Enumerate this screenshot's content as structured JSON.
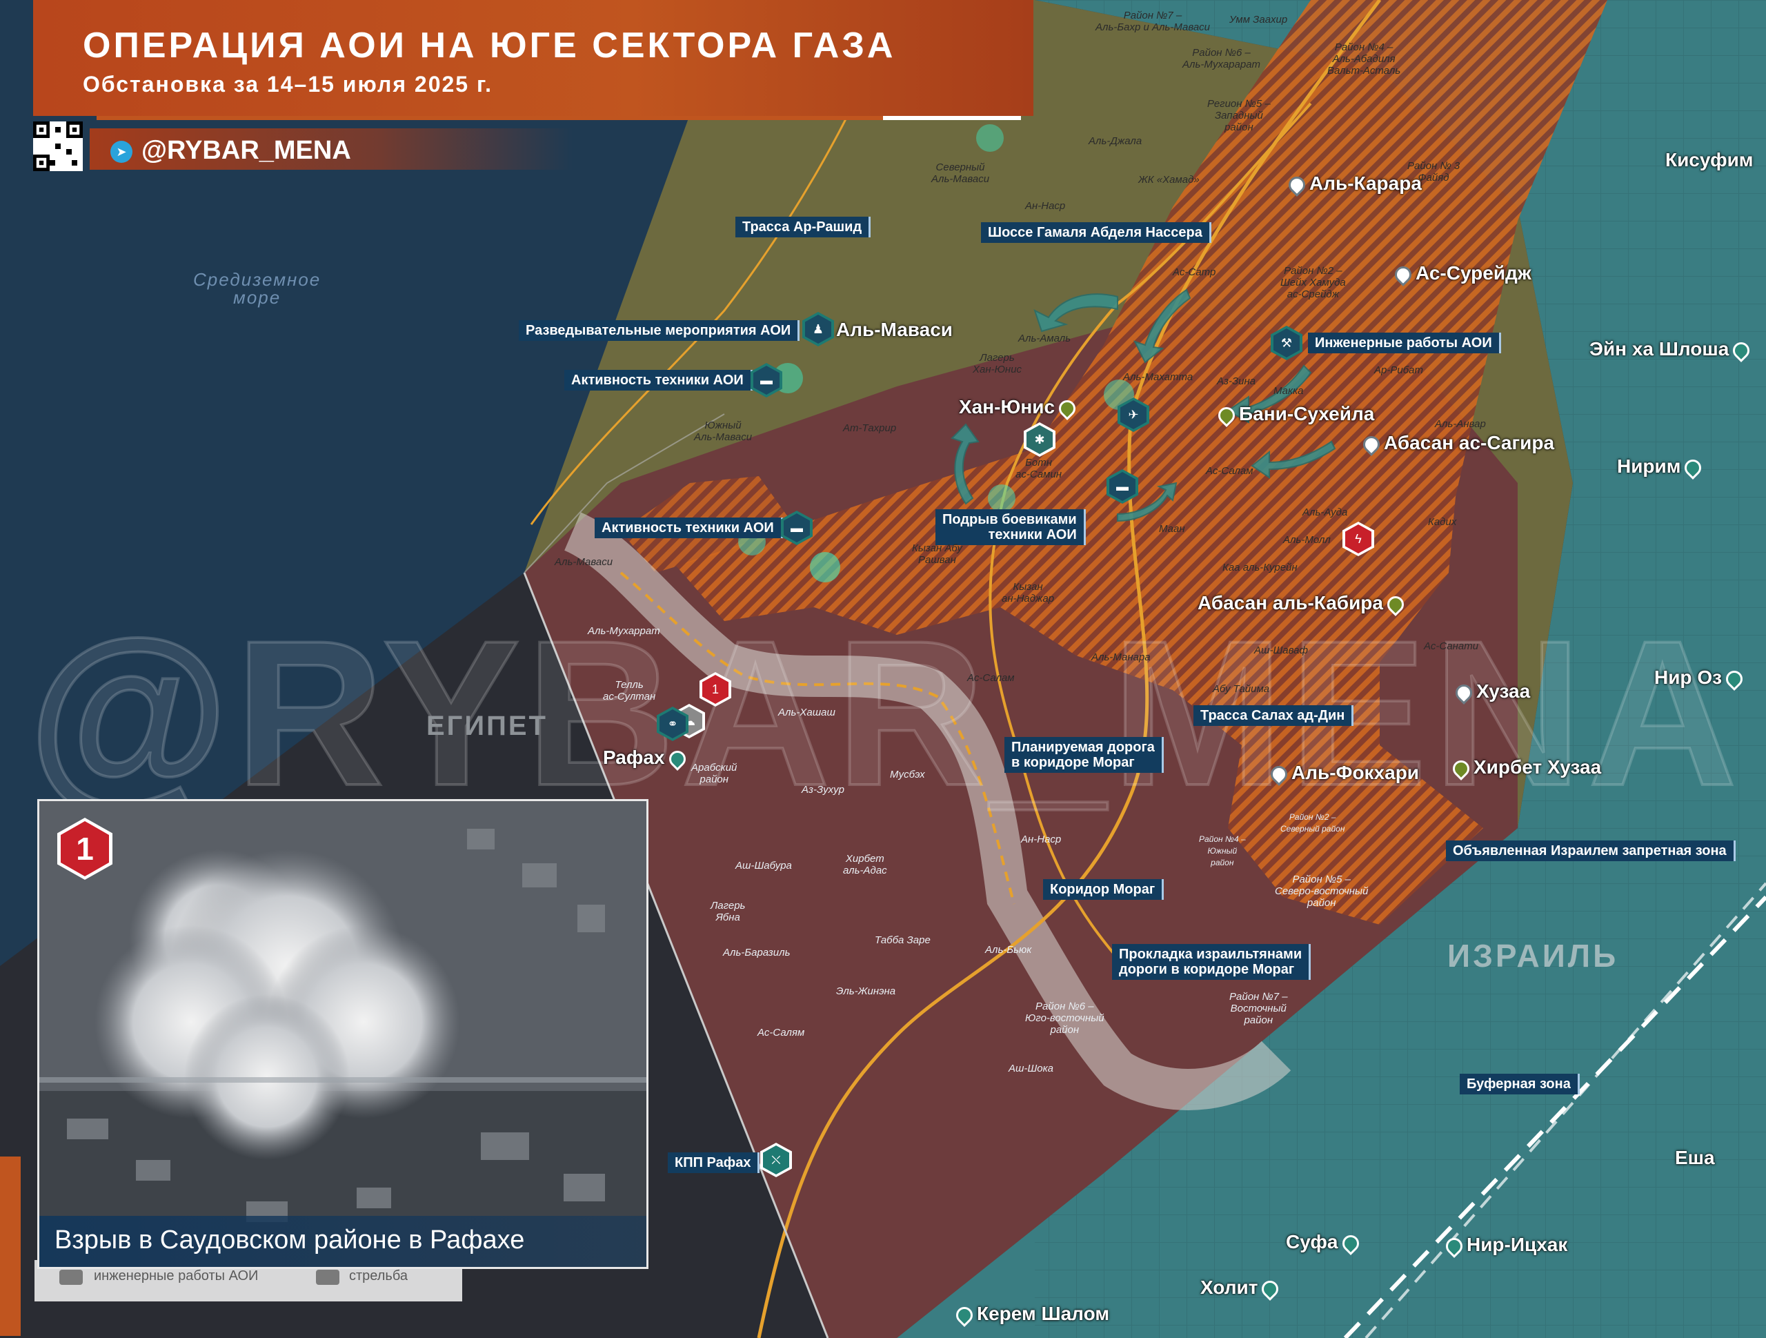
{
  "header": {
    "title": "ОПЕРАЦИЯ АОИ НА ЮГЕ СЕКТОРА ГАЗА",
    "subtitle": "Обстановка за 14–15 июля 2025 г.",
    "brand": "@RYBAR_MENA"
  },
  "map_labels": {
    "sea": [
      "Средиземное",
      "море"
    ],
    "countries": {
      "egypt": "ЕГИПЕТ",
      "israel": "ИЗРАИЛЬ"
    },
    "watermark": "@RYBAR_MENA"
  },
  "callouts": {
    "rashid": "Трасса Ар-Рашид",
    "nasser": "Шоссе Гамаля Абделя Нассера",
    "recon": "Разведывательные мероприятия АОИ",
    "activity1": "Активность техники АОИ",
    "activity2": "Активность техники АОИ",
    "engineering": "Инженерные работы АОИ",
    "blowup": [
      "Подрыв боевиками",
      "техники АОИ"
    ],
    "salah": "Трасса Салах ад-Дин",
    "planned_road": [
      "Планируемая дорога",
      "в коридоре Мораг"
    ],
    "zone": "Объявленная Израилем запретная зона",
    "morag": "Коридор Мораг",
    "laying": [
      "Прокладка израильтянами",
      "дороги в коридоре Мораг"
    ],
    "buffer": "Буферная зона",
    "kpp": "КПП Рафах"
  },
  "places": {
    "mawasi": "Аль-Маваси",
    "khan_younis": "Хан-Юнис",
    "karara": "Аль-Карара",
    "sureidj": "Ас-Сурейдж",
    "bani_suheila": "Бани-Сухейла",
    "abasan_sagira": "Абасан ас-Сагира",
    "abasan_kabira": "Абасан аль-Кабира",
    "khuzaa": "Хузаа",
    "khirbet_khuzaa": "Хирбет Хузаа",
    "fokhari": "Аль-Фокхари",
    "rafah": "Рафах",
    "kissufim": "Кисуфим",
    "ein_hashlosha": "Эйн ха Шлоша",
    "nirim": "Нирим",
    "nir_oz": "Нир Оз",
    "esha": "Еша",
    "sufa": "Суфа",
    "nir_yitzhak": "Нир-Ицхак",
    "holit": "Холит",
    "kerem_shalom": "Керем Шалом"
  },
  "districts": {
    "d7": [
      "Район №7 –",
      "Аль-Бахр и Аль-Маваси"
    ],
    "umm": "Умм Заахир",
    "d4": [
      "Район №4 –",
      "Аль-Абадиля",
      "Вальт-Асталь"
    ],
    "d6": [
      "Район №6 –",
      "Аль-Мухарарат"
    ],
    "d5": [
      "Регион №5 –",
      "Западный",
      "район"
    ],
    "aljala": "Аль-Джала",
    "hamad": "ЖК «Хамад»",
    "d3": [
      "Район № 3",
      "Файяд"
    ],
    "north_mawasi": [
      "Северный",
      "Аль-Маваси"
    ],
    "an_nasr1": "Ан-Наср",
    "as_satr": "Ас-Сатр",
    "d2": [
      "Район №2 –",
      "Шейх Хамуда",
      "ас-Срейдж"
    ],
    "al_amal": "Аль-Амаль",
    "camp_ky": [
      "Лагерь",
      "Хан-Юнис"
    ],
    "az_zina": "Аз-Зина",
    "ar_ribat": "Ар-Рибат",
    "mahatta": "Аль-Махатта",
    "makka": "Макка",
    "at_tahrir": "Ат-Тахрир",
    "anwar": "Аль-Анвар",
    "south_mawasi": [
      "Южный",
      "Аль-Маваси"
    ],
    "batn": [
      "Ботн",
      "ас-Самин"
    ],
    "as_salam1": "Ас-Салам",
    "auda": "Аль-Ауда",
    "kadikh": "Кадих",
    "al_moll": "Аль-Молл",
    "maan": "Маан",
    "qizan_abu": [
      "Кызан Абу",
      "Рашван"
    ],
    "kaa_qurein": "Каа аль-Курейн",
    "mawasi2": "Аль-Маваси",
    "qizan_najjar": [
      "Кызан",
      "ан-Наджар"
    ],
    "muharrat": "Аль-Мухаррат",
    "shawaf": "Аш-Шаваф",
    "as_sanati": "Ас-Санати",
    "manara": "Аль-Манара",
    "tell_sultan": [
      "Телль",
      "ас-Султан"
    ],
    "as_salam2": "Ас-Салам",
    "abu_taima": "Абу Тайима",
    "hashash": "Аль-Хашаш",
    "arab": [
      "Арабский",
      "район"
    ],
    "musbah": "Мусбэх",
    "zuhur": "Аз-Зухур",
    "an_nasr2": "Ан-Наср",
    "d2n": [
      "Район №2 –",
      "Северный район"
    ],
    "d4s": [
      "Район №4 –",
      "Южный",
      "район"
    ],
    "shabura": "Аш-Шабура",
    "khirbet_adas": [
      "Хирбет",
      "аль-Адас"
    ],
    "d5e": [
      "Район №5 –",
      "Северо-восточный",
      "район"
    ],
    "camp_yabna": [
      "Лагерь",
      "Ябна"
    ],
    "tabba": "Табба Заре",
    "barazil": "Аль-Баразиль",
    "byuk": "Аль-Бьюк",
    "jinena": "Эль-Жинэна",
    "d6se": [
      "Район №6 –",
      "Юго-восточный",
      "район"
    ],
    "d7e": [
      "Район №7 –",
      "Восточный",
      "район"
    ],
    "as_salam3": "Ас-Салям",
    "ash_shoka": "Аш-Шока"
  },
  "inset": {
    "number": "1",
    "caption": "Взрыв в Саудовском районе в Рафахе"
  },
  "legend": {
    "eng": "инженерные работы АОИ",
    "fire": "стрельба"
  },
  "colors": {
    "sea": "#1f3a52",
    "gaza": "#6d6a3f",
    "occupied": "#8a3e2a",
    "zone_orange": "#c8621e",
    "israel": "#3a7d82",
    "egypt": "#2a2c33",
    "header": "#b8461c",
    "callout_bg": "#123c5e",
    "road": "#e6a12d"
  }
}
